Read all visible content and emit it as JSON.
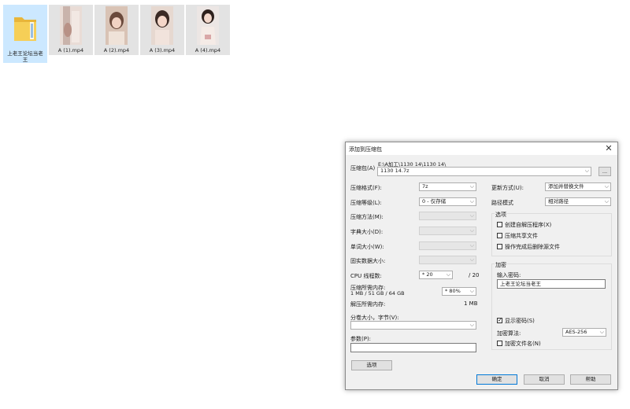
{
  "desktop": {
    "files": [
      {
        "name": "上老王论坛当老王",
        "type": "folder"
      },
      {
        "name": "A (1).mp4",
        "type": "video"
      },
      {
        "name": "A (2).mp4",
        "type": "video"
      },
      {
        "name": "A (3).mp4",
        "type": "video"
      },
      {
        "name": "A (4).mp4",
        "type": "video"
      }
    ]
  },
  "dialog": {
    "title": "添加到压缩包",
    "archive": {
      "label": "压缩包(A)",
      "path": "E:\\A加工\\1130 14\\1130 14\\",
      "name": "1130 14.7z",
      "browse_label": "..."
    },
    "left": {
      "format_label": "压缩格式(F):",
      "format_value": "7z",
      "level_label": "压缩等级(L):",
      "level_value": "0 - 仅存储",
      "method_label": "压缩方法(M):",
      "dict_label": "字典大小(D):",
      "word_label": "单词大小(W):",
      "solid_label": "固实数据大小:",
      "cpu_label": "CPU 线程数:",
      "cpu_value": "* 20",
      "cpu_total": "/ 20",
      "mem_label": "压缩所需内存:",
      "mem_info": "1 MB / 51 GB / 64 GB",
      "mem_value": "* 80%",
      "decomp_label": "解压所需内存:",
      "decomp_value": "1 MB",
      "split_label": "分卷大小，字节(V):",
      "params_label": "参数(P):",
      "options_button": "选项"
    },
    "right": {
      "update_label": "更新方式(U):",
      "update_value": "添加并替换文件",
      "pathmode_label": "路径模式",
      "pathmode_value": "相对路径",
      "options_group": "选项",
      "opt_sfx": "创建自解压程序(X)",
      "opt_shared": "压缩共享文件",
      "opt_delete": "操作完成后删除源文件",
      "encrypt_group": "加密",
      "password_label": "输入密码:",
      "password_value": "上老王论坛当老王",
      "show_password": "显示密码(S)",
      "show_password_checked": true,
      "method_label": "加密算法:",
      "method_value": "AES-256",
      "encrypt_names": "加密文件名(N)"
    },
    "buttons": {
      "ok": "确定",
      "cancel": "取消",
      "help": "帮助"
    }
  }
}
